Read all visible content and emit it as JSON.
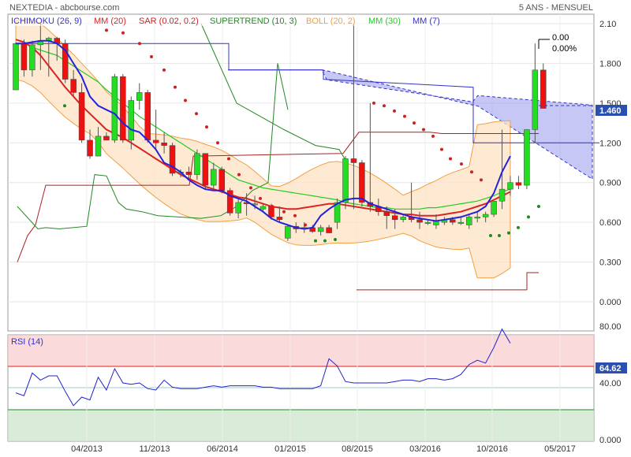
{
  "header": {
    "left": "NEXTEDIA - abcbourse.com",
    "right": "5 ANS - MENSUEL"
  },
  "legend": [
    {
      "label": "ICHIMOKU (26, 9)",
      "color": "#3333cc"
    },
    {
      "label": "MM (20)",
      "color": "#dd2222"
    },
    {
      "label": "SAR (0.02, 0.2)",
      "color": "#cc2222"
    },
    {
      "label": "SUPERTREND (10, 3)",
      "color": "#228822"
    },
    {
      "label": "BOLL (20, 2)",
      "color": "#f0a040"
    },
    {
      "label": "MM (30)",
      "color": "#22cc22"
    },
    {
      "label": "MM (7)",
      "color": "#3333cc"
    }
  ],
  "price_badge": "1.460",
  "rsi_badge": "64.62",
  "annotation": {
    "line1": "0.00",
    "line2": "0.00%"
  },
  "chart_data": {
    "type": "candlestick",
    "title": "NEXTEDIA",
    "x_tick_labels": [
      "04/2013",
      "11/2013",
      "06/2014",
      "01/2015",
      "08/2015",
      "03/2016",
      "10/2016",
      "05/2017"
    ],
    "y_ticks": [
      "2.10",
      "1.800",
      "1.500",
      "1.200",
      "0.900",
      "0.600",
      "0.300",
      "0.000"
    ],
    "ylim": [
      0,
      2.1
    ],
    "candles": [
      [
        1.6,
        1.96,
        1.6,
        1.95
      ],
      [
        1.95,
        1.98,
        1.7,
        1.75
      ],
      [
        1.75,
        1.97,
        1.7,
        1.94
      ],
      [
        1.94,
        2.1,
        1.75,
        1.97
      ],
      [
        1.97,
        2.0,
        1.7,
        1.99
      ],
      [
        1.99,
        2.0,
        1.82,
        1.95
      ],
      [
        1.95,
        1.98,
        1.65,
        1.68
      ],
      [
        1.68,
        1.75,
        1.55,
        1.58
      ],
      [
        1.58,
        1.65,
        1.2,
        1.22
      ],
      [
        1.22,
        1.3,
        1.08,
        1.1
      ],
      [
        1.1,
        1.32,
        1.1,
        1.25
      ],
      [
        1.25,
        1.28,
        1.22,
        1.22
      ],
      [
        1.22,
        1.72,
        1.2,
        1.7
      ],
      [
        1.7,
        1.72,
        1.2,
        1.22
      ],
      [
        1.22,
        1.55,
        1.15,
        1.52
      ],
      [
        1.52,
        1.65,
        1.45,
        1.58
      ],
      [
        1.58,
        1.6,
        1.2,
        1.22
      ],
      [
        1.22,
        1.45,
        1.15,
        1.2
      ],
      [
        1.2,
        1.28,
        1.12,
        1.18
      ],
      [
        1.18,
        1.2,
        0.95,
        0.97
      ],
      [
        0.97,
        1.0,
        0.94,
        0.98
      ],
      [
        0.98,
        1.02,
        0.92,
        0.96
      ],
      [
        0.96,
        1.15,
        0.92,
        1.12
      ],
      [
        1.12,
        1.12,
        0.85,
        0.88
      ],
      [
        0.88,
        1.05,
        0.85,
        1.0
      ],
      [
        1.0,
        1.02,
        0.82,
        0.84
      ],
      [
        0.84,
        0.86,
        0.65,
        0.67
      ],
      [
        0.67,
        0.78,
        0.63,
        0.75
      ],
      [
        0.75,
        0.82,
        0.65,
        0.74
      ],
      [
        0.74,
        0.8,
        0.7,
        0.74
      ],
      [
        0.7,
        0.74,
        0.68,
        0.72
      ],
      [
        0.72,
        0.74,
        0.62,
        0.64
      ],
      [
        0.64,
        0.72,
        0.6,
        0.62
      ],
      [
        0.48,
        0.58,
        0.46,
        0.57
      ],
      [
        0.57,
        0.6,
        0.52,
        0.55
      ],
      [
        0.55,
        0.6,
        0.52,
        0.56
      ],
      [
        0.56,
        0.58,
        0.52,
        0.53
      ],
      [
        0.53,
        0.58,
        0.5,
        0.56
      ],
      [
        0.56,
        0.58,
        0.52,
        0.52
      ],
      [
        0.6,
        0.78,
        0.55,
        0.75
      ],
      [
        0.75,
        1.1,
        0.7,
        1.08
      ],
      [
        1.08,
        2.1,
        0.7,
        1.05
      ],
      [
        1.05,
        1.07,
        0.72,
        0.75
      ],
      [
        0.75,
        1.5,
        0.68,
        0.72
      ],
      [
        0.72,
        0.78,
        0.65,
        0.68
      ],
      [
        0.68,
        0.72,
        0.55,
        0.65
      ],
      [
        0.65,
        0.7,
        0.55,
        0.62
      ],
      [
        0.62,
        0.66,
        0.6,
        0.64
      ],
      [
        0.64,
        0.9,
        0.6,
        0.62
      ],
      [
        0.62,
        0.68,
        0.55,
        0.6
      ],
      [
        0.6,
        0.62,
        0.58,
        0.6
      ],
      [
        0.58,
        0.66,
        0.55,
        0.61
      ],
      [
        0.6,
        0.64,
        0.58,
        0.62
      ],
      [
        0.62,
        0.64,
        0.58,
        0.6
      ],
      [
        0.6,
        0.64,
        0.58,
        0.6
      ],
      [
        0.58,
        0.66,
        0.55,
        0.64
      ],
      [
        0.64,
        0.68,
        0.6,
        0.64
      ],
      [
        0.64,
        0.68,
        0.6,
        0.66
      ],
      [
        0.66,
        0.76,
        0.64,
        0.76
      ],
      [
        0.76,
        1.3,
        0.7,
        0.85
      ],
      [
        0.85,
        0.95,
        0.8,
        0.9
      ],
      [
        0.9,
        0.95,
        0.85,
        0.88
      ],
      [
        0.88,
        1.3,
        0.85,
        1.3
      ],
      [
        1.3,
        1.95,
        1.2,
        1.75
      ],
      [
        1.75,
        1.8,
        1.46,
        1.46
      ]
    ],
    "ma20": [
      1.98,
      1.96,
      1.92,
      1.86,
      1.78,
      1.7,
      1.62,
      1.55,
      1.48,
      1.42,
      1.36,
      1.3,
      1.27,
      1.24,
      1.2,
      1.16,
      1.12,
      1.08,
      1.04,
      1.0,
      0.96,
      0.93,
      0.9,
      0.87,
      0.85,
      0.83,
      0.81,
      0.79,
      0.78,
      0.76,
      0.74,
      0.72,
      0.71,
      0.7,
      0.7,
      0.71,
      0.72,
      0.73,
      0.74,
      0.74,
      0.73,
      0.72,
      0.71,
      0.7,
      0.69,
      0.68,
      0.67,
      0.66,
      0.66,
      0.65,
      0.65,
      0.65,
      0.66,
      0.67,
      0.68,
      0.7,
      0.72,
      0.74,
      0.77,
      0.8,
      0.83
    ],
    "ma30": [
      1.98,
      1.96,
      1.92,
      1.9,
      1.88,
      1.86,
      1.82,
      1.78,
      1.74,
      1.7,
      1.66,
      1.6,
      1.55,
      1.5,
      1.45,
      1.4,
      1.36,
      1.32,
      1.28,
      1.24,
      1.2,
      1.16,
      1.12,
      1.08,
      1.04,
      1.0,
      0.96,
      0.92,
      0.9,
      0.88,
      0.86,
      0.85,
      0.84,
      0.83,
      0.82,
      0.81,
      0.8,
      0.79,
      0.78,
      0.77,
      0.75,
      0.74,
      0.73,
      0.72,
      0.71,
      0.71,
      0.7,
      0.7,
      0.7,
      0.7,
      0.71,
      0.71,
      0.72,
      0.73,
      0.74,
      0.75,
      0.76,
      0.78,
      0.8,
      0.83,
      0.85
    ],
    "ma7": [
      1.95,
      1.95,
      1.96,
      1.97,
      1.97,
      1.95,
      1.9,
      1.8,
      1.7,
      1.55,
      1.48,
      1.45,
      1.42,
      1.35,
      1.3,
      1.28,
      1.22,
      1.15,
      1.05,
      1.02,
      0.98,
      0.92,
      0.88,
      0.85,
      0.84,
      0.84,
      0.8,
      0.78,
      0.76,
      0.72,
      0.68,
      0.63,
      0.6,
      0.58,
      0.56,
      0.55,
      0.56,
      0.65,
      0.7,
      0.74,
      0.77,
      0.78,
      0.78,
      0.74,
      0.72,
      0.7,
      0.68,
      0.66,
      0.64,
      0.63,
      0.62,
      0.61,
      0.62,
      0.63,
      0.64,
      0.66,
      0.68,
      0.72,
      0.82,
      0.98,
      1.1
    ],
    "rsi": {
      "title": "RSI (14)",
      "ylim": [
        0,
        100
      ],
      "y_ticks": [
        "80.00",
        "40.00",
        "0.000"
      ],
      "overbought": 70,
      "oversold": 30,
      "mid": 50,
      "values": [
        33,
        31,
        47,
        42,
        45,
        45,
        34,
        24,
        30,
        28,
        44,
        35,
        50,
        40,
        39,
        40,
        36,
        35,
        42,
        37,
        36,
        36,
        36,
        37,
        38,
        37,
        38,
        38,
        38,
        38,
        37,
        37,
        36,
        36,
        36,
        36,
        36,
        38,
        57,
        52,
        41,
        40,
        40,
        40,
        40,
        40,
        41,
        42,
        42,
        41,
        43,
        43,
        42,
        43,
        46,
        53,
        56,
        54,
        65,
        78,
        68
      ]
    }
  }
}
